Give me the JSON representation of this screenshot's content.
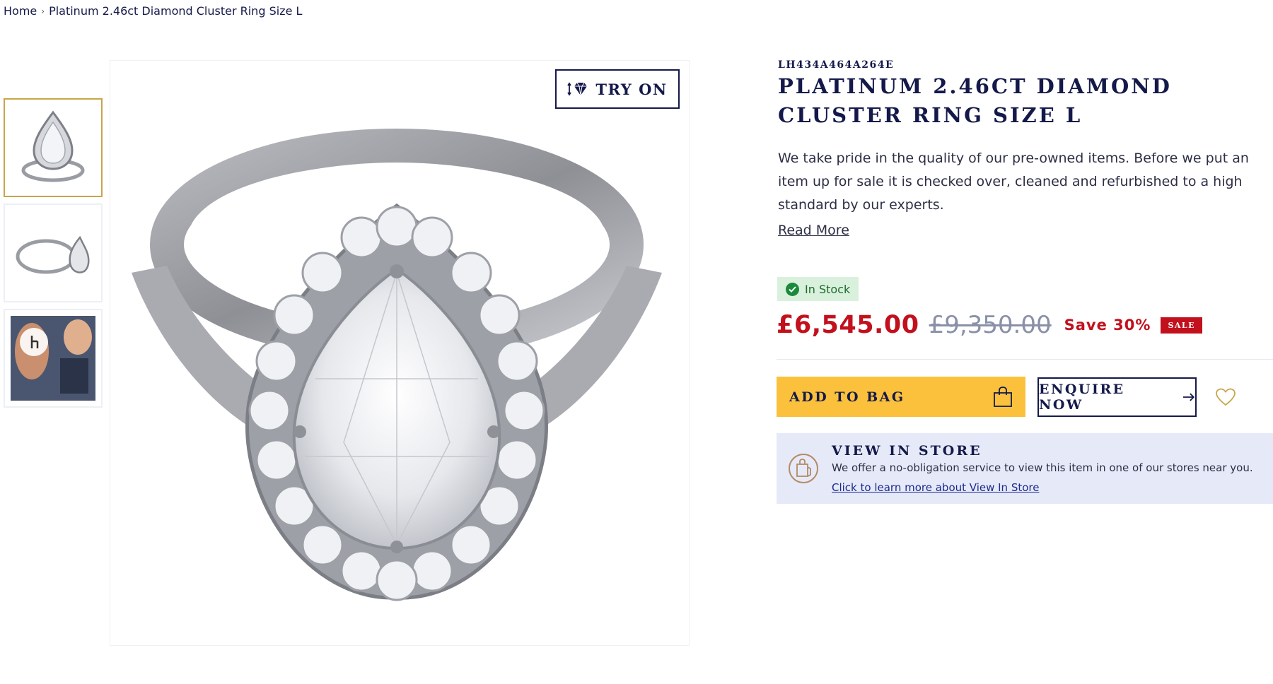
{
  "breadcrumb": {
    "home": "Home",
    "current": "Platinum 2.46ct Diamond Cluster Ring Size L"
  },
  "gallery": {
    "thumbnails": [
      {
        "icon": "ring-front-thumbnail",
        "active": true
      },
      {
        "icon": "ring-side-thumbnail",
        "active": false
      },
      {
        "icon": "lifestyle-video-thumbnail",
        "active": false
      }
    ],
    "try_on_label": "TRY ON"
  },
  "product": {
    "sku": "LH434A464A264E",
    "title": "PLATINUM 2.46CT DIAMOND CLUSTER RING SIZE L",
    "description": "We take pride in the quality of our pre-owned items. Before we put an item up for sale it is checked over, cleaned and refurbished to a high standard by our experts.",
    "read_more": "Read More",
    "stock": "In Stock",
    "price_now": "£6,545.00",
    "price_was": "£9,350.00",
    "save": "Save 30%",
    "sale_badge": "SALE"
  },
  "actions": {
    "add_to_bag": "ADD TO BAG",
    "enquire_now": "ENQUIRE NOW"
  },
  "view_in_store": {
    "heading": "VIEW IN STORE",
    "text": "We offer a no-obligation service to view this item in one of our stores near you.",
    "link": "Click to learn more about View In Store"
  },
  "colors": {
    "navy": "#14194a",
    "gold_accent": "#c9a54a",
    "bag_yellow": "#fbc13d",
    "sale_red": "#c3101d",
    "stock_green": "#1a8a3a",
    "store_panel": "#e6eaf8"
  }
}
